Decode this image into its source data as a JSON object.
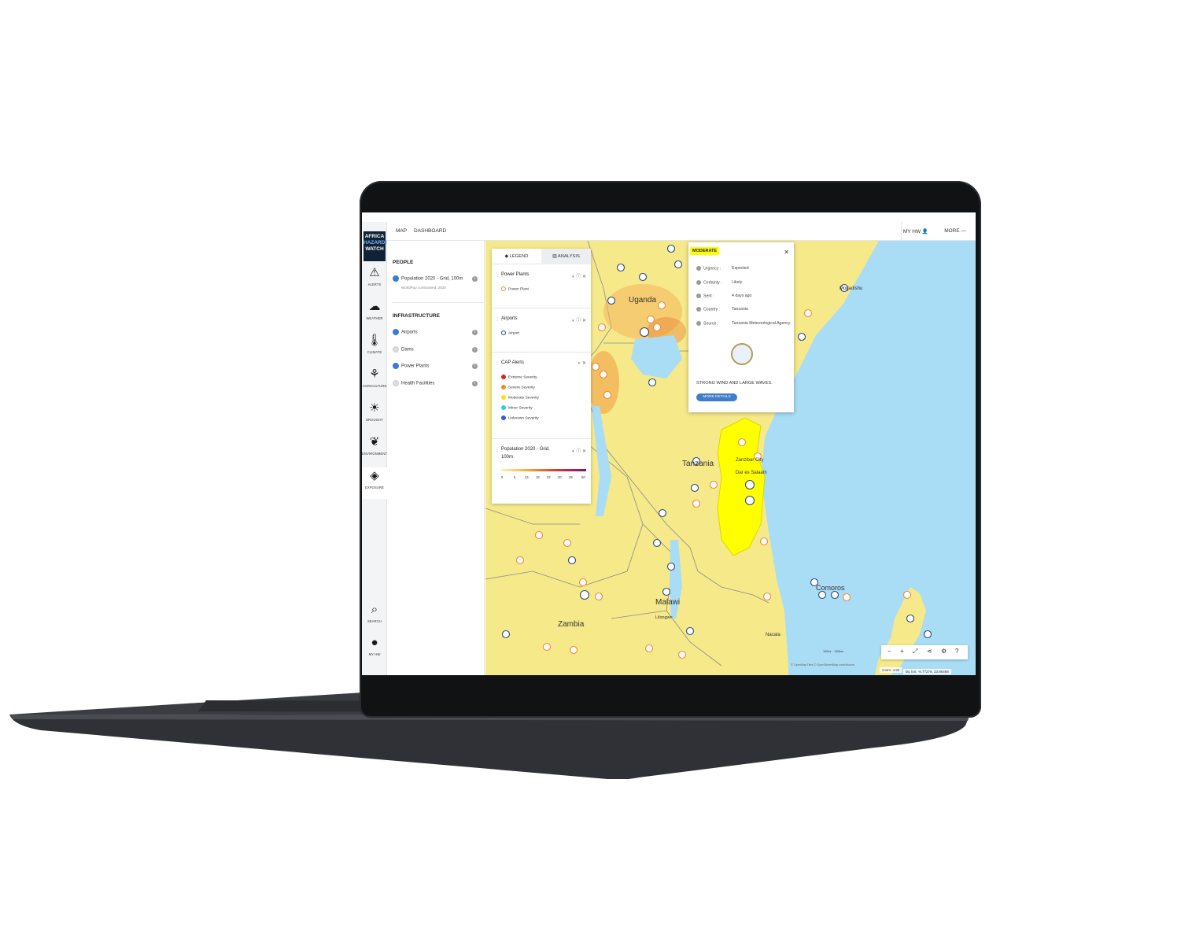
{
  "brand": {
    "line1": "AFRICA",
    "line2": "HAZARDS",
    "line3": "WATCH"
  },
  "header": {
    "tabs": [
      "MAP",
      "DASHBOARD"
    ],
    "my_hw": "MY HW",
    "more": "MORE"
  },
  "sidebar": {
    "items": [
      {
        "label": "ALERTS",
        "icon": "warning-icon"
      },
      {
        "label": "WEATHER",
        "icon": "rain-cloud-icon"
      },
      {
        "label": "CLIMATE",
        "icon": "thermometer-icon"
      },
      {
        "label": "AGRICULTURE",
        "icon": "wheat-icon"
      },
      {
        "label": "DROUGHT",
        "icon": "drought-icon"
      },
      {
        "label": "ENVIRONMENT",
        "icon": "leaf-icon"
      },
      {
        "label": "EXPOSURE",
        "icon": "layers-icon"
      }
    ],
    "bottom": [
      {
        "label": "SEARCH",
        "icon": "search-icon"
      },
      {
        "label": "MY HW",
        "icon": "user-icon"
      }
    ]
  },
  "layers_panel": {
    "people_title": "PEOPLE",
    "people_layer": "Population 2020 - Grid, 100m",
    "people_note": "WorldPop constrained, 2020",
    "infra_title": "INFRASTRUCTURE",
    "infra_layers": [
      "Airports",
      "Dams",
      "Power Plants",
      "Health Facilities"
    ]
  },
  "legend": {
    "tab_legend": "LEGEND",
    "tab_analysis": "ANALYSIS",
    "power_title": "Power Plants",
    "power_item": "Power Plant",
    "airports_title": "Airports",
    "airports_item": "Airport",
    "cap_title": "CAP Alerts",
    "cap_items": [
      "Extreme Severity",
      "Severe Severity",
      "Moderate Severity",
      "Minor Severity",
      "Unknown Severity"
    ],
    "cap_colors": [
      "#d7261e",
      "#f08a1c",
      "#f5e400",
      "#22d0e0",
      "#2f5be0"
    ],
    "pop_title": "Population 2020 - Grid,",
    "pop_title2": "100m",
    "pop_ticks": [
      "0",
      "6",
      "14",
      "18",
      "22",
      "30",
      "38",
      "50"
    ]
  },
  "popup": {
    "severity": "MODERATE",
    "rows": [
      {
        "k": "Urgency :",
        "v": "Expected"
      },
      {
        "k": "Certainty :",
        "v": "Likely"
      },
      {
        "k": "Sent :",
        "v": "4 days ago"
      },
      {
        "k": "Country :",
        "v": "Tanzania"
      },
      {
        "k": "Source :",
        "v": "Tanzania Meteorological Agency"
      }
    ],
    "description": "STRONG WIND AND LARGE WAVES.",
    "more_details": "MORE DETAILS"
  },
  "map_labels": {
    "uganda": "Uganda",
    "tanzania": "Tanzania",
    "zambia": "Zambia",
    "malawi": "Malawi",
    "comoros": "Comoros",
    "mogadishu": "Mogadishu",
    "lilongwe": "Lilongwe",
    "nacala": "Nacala",
    "zanzibar": "Zanzibar City",
    "dar": "Dar es Salaam"
  },
  "map_footer": {
    "zoom": "zoom: 4.93",
    "coords": "lat, lon: -6.77276, 33.86468",
    "scale1": "100mi",
    "scale2": "200km",
    "attribution": "© OpenMapTiles © OpenStreetMap contributors"
  },
  "colors": {
    "land": "#f6e98a",
    "sea": "#a9dcf5",
    "alert_zone": "#ffff00",
    "accent": "#3f7dc8"
  }
}
